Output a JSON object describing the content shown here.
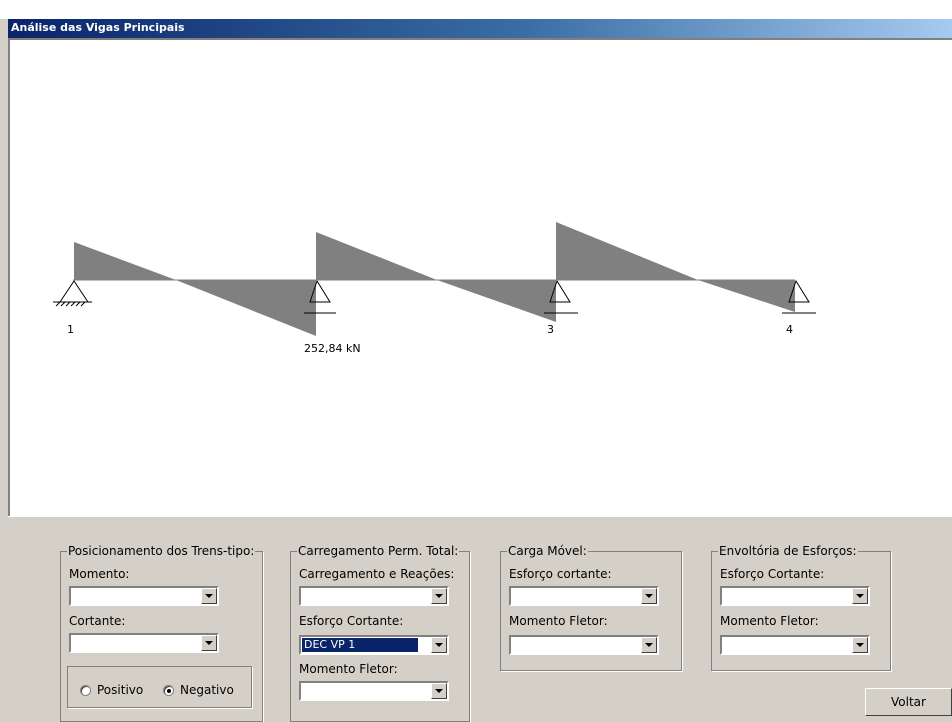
{
  "window": {
    "title": "Análise das Vigas Principais"
  },
  "diagram": {
    "support_labels": [
      "1",
      "3",
      "4"
    ],
    "max_shear_label": "252,84 kN",
    "fill_color": "#808080"
  },
  "groups": {
    "trens_tipo": {
      "legend": "Posicionamento dos Trens-tipo:",
      "momento_label": "Momento:",
      "momento_value": "",
      "cortante_label": "Cortante:",
      "cortante_value": "",
      "radio_positivo": "Positivo",
      "radio_negativo": "Negativo",
      "selected": "Negativo"
    },
    "perm_total": {
      "legend": "Carregamento Perm. Total:",
      "carregamento_label": "Carregamento e Reações:",
      "carregamento_value": "",
      "cortante_label": "Esforço Cortante:",
      "cortante_value": "DEC VP 1",
      "momento_label": "Momento Fletor:",
      "momento_value": ""
    },
    "carga_movel": {
      "legend": "Carga Móvel:",
      "cortante_label": "Esforço cortante:",
      "cortante_value": "",
      "momento_label": "Momento Fletor:",
      "momento_value": ""
    },
    "envoltoria": {
      "legend": "Envoltória de Esforços:",
      "cortante_label": "Esforço Cortante:",
      "cortante_value": "",
      "momento_label": "Momento Fletor:",
      "momento_value": ""
    }
  },
  "buttons": {
    "voltar": "Voltar"
  }
}
